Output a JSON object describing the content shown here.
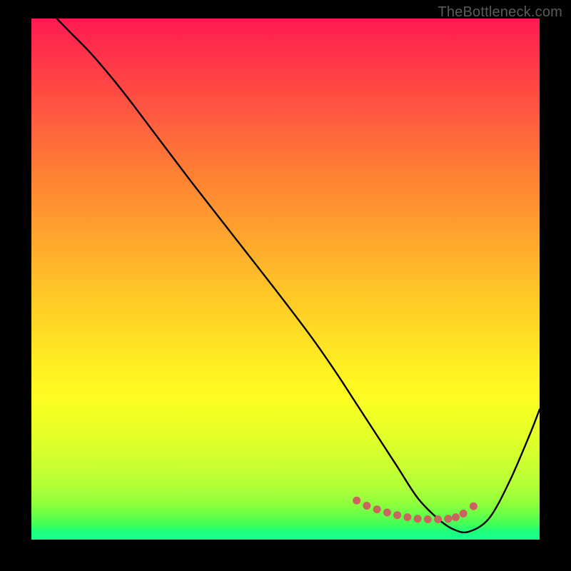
{
  "watermark": "TheBottleneck.com",
  "chart_data": {
    "type": "line",
    "title": "",
    "xlabel": "",
    "ylabel": "",
    "ylim": [
      0,
      100
    ],
    "xlim": [
      0,
      100
    ],
    "series": [
      {
        "name": "curve",
        "x": [
          5,
          8,
          12,
          18,
          25,
          32,
          40,
          48,
          55,
          60,
          64,
          68,
          72,
          76,
          80,
          83,
          86,
          90,
          94,
          98,
          100
        ],
        "y": [
          100,
          97,
          93,
          86,
          77,
          68,
          58,
          48,
          39,
          32,
          26,
          20,
          14,
          8,
          4,
          2,
          1.5,
          4,
          11,
          20,
          25
        ]
      },
      {
        "name": "highlight-dots",
        "x": [
          64,
          66,
          68,
          70,
          72,
          74,
          76,
          78,
          80,
          82,
          83.5,
          85,
          87
        ],
        "y": [
          7.5,
          6.5,
          5.8,
          5.2,
          4.7,
          4.3,
          4.0,
          3.9,
          3.9,
          4.0,
          4.3,
          5.0,
          6.4
        ]
      }
    ],
    "background_gradient": {
      "top": "#ff1a52",
      "mid": "#ffed22",
      "bottom": "#18ff8f"
    }
  }
}
